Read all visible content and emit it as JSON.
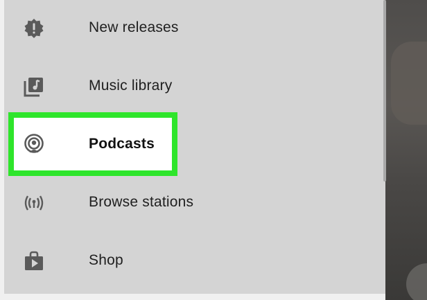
{
  "drawer": {
    "items": [
      {
        "label": "New releases",
        "icon": "new-releases-icon"
      },
      {
        "label": "Music library",
        "icon": "music-library-icon"
      },
      {
        "label": "Podcasts",
        "icon": "podcasts-icon",
        "highlighted": true
      },
      {
        "label": "Browse stations",
        "icon": "radio-stations-icon"
      },
      {
        "label": "Shop",
        "icon": "shop-icon"
      }
    ],
    "highlight_color": "#2ee52b"
  }
}
